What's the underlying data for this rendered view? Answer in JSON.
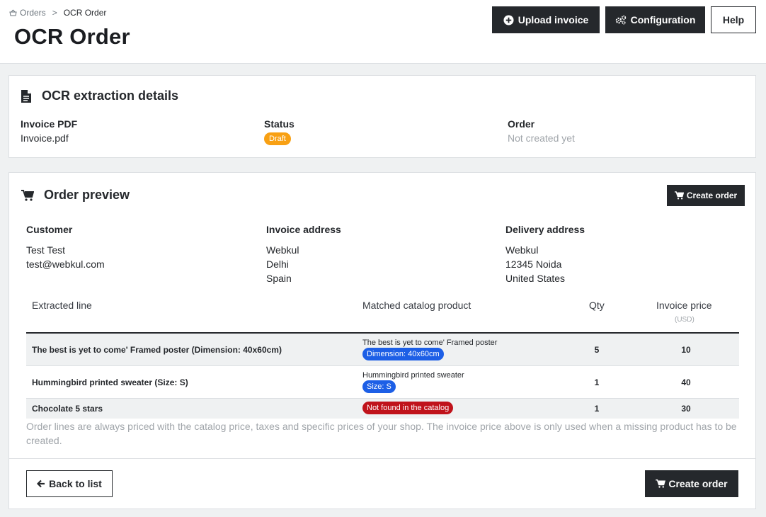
{
  "breadcrumb": {
    "parent": "Orders",
    "separator": ">",
    "current": "OCR Order"
  },
  "header": {
    "title": "OCR Order",
    "buttons": {
      "upload": "Upload invoice",
      "configuration": "Configuration",
      "help": "Help"
    }
  },
  "extraction": {
    "title": "OCR extraction details",
    "invoice_pdf_label": "Invoice PDF",
    "invoice_pdf_value": "Invoice.pdf",
    "status_label": "Status",
    "status_value": "Draft",
    "order_label": "Order",
    "order_value": "Not created yet"
  },
  "preview": {
    "title": "Order preview",
    "create_order_label": "Create order",
    "customer": {
      "label": "Customer",
      "lines": [
        "Test Test",
        "test@webkul.com"
      ]
    },
    "invoice_address": {
      "label": "Invoice address",
      "lines": [
        "Webkul",
        "Delhi",
        "Spain"
      ]
    },
    "delivery_address": {
      "label": "Delivery address",
      "lines": [
        "Webkul",
        "12345 Noida",
        "United States"
      ]
    },
    "table": {
      "headers": {
        "line": "Extracted line",
        "product": "Matched catalog product",
        "qty": "Qty",
        "price": "Invoice price",
        "currency": "(USD)"
      },
      "rows": [
        {
          "line": "The best is yet to come' Framed poster (Dimension: 40x60cm)",
          "product": "The best is yet to come' Framed poster",
          "attribute": "Dimension: 40x60cm",
          "qty": "5",
          "price": "10"
        },
        {
          "line": "Hummingbird printed sweater (Size: S)",
          "product": "Hummingbird printed sweater",
          "attribute": "Size: S",
          "qty": "1",
          "price": "40"
        },
        {
          "line": "Chocolate 5 stars",
          "not_found": "Not found in the catalog",
          "qty": "1",
          "price": "30"
        }
      ]
    },
    "note": "Order lines are always priced with the catalog price, taxes and specific prices of your shop. The invoice price above is only used when a missing product has to be created.",
    "back_label": "Back to list",
    "create_order_footer_label": "Create order"
  },
  "colors": {
    "dark": "#25282c",
    "draft": "#f8a013",
    "blue_pill": "#1d5fe6",
    "red_pill": "#c0131b",
    "muted": "#a0a5aa"
  },
  "icons": [
    "basket-icon",
    "plus-circle-icon",
    "gears-icon",
    "file-text-icon",
    "cart-icon",
    "arrow-left-icon"
  ]
}
